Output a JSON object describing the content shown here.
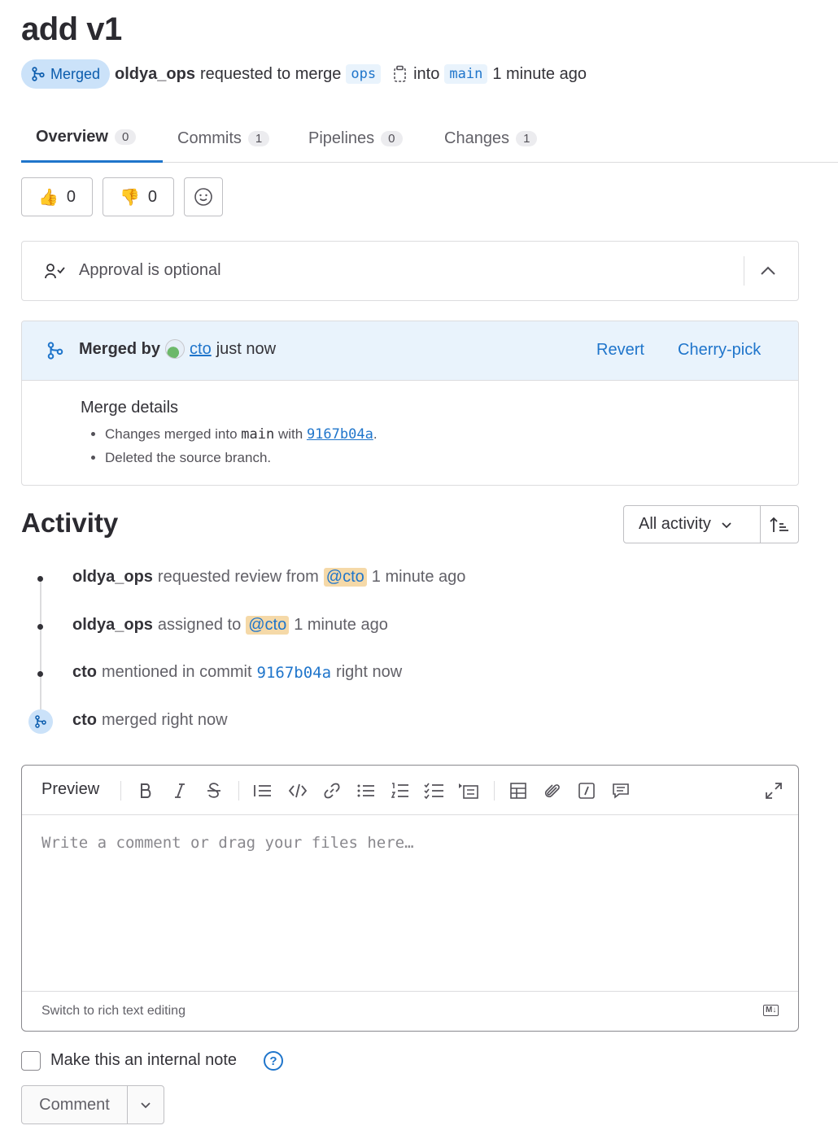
{
  "title": "add v1",
  "meta": {
    "status": "Merged",
    "author": "oldya_ops",
    "action": "requested to merge",
    "source_branch": "ops",
    "into": "into",
    "target_branch": "main",
    "time": "1 minute ago"
  },
  "tabs": [
    {
      "label": "Overview",
      "count": "0"
    },
    {
      "label": "Commits",
      "count": "1"
    },
    {
      "label": "Pipelines",
      "count": "0"
    },
    {
      "label": "Changes",
      "count": "1"
    }
  ],
  "reactions": {
    "thumbs_up": "0",
    "thumbs_down": "0"
  },
  "approval": {
    "text": "Approval is optional"
  },
  "merge": {
    "merged_by": "Merged by",
    "user": "cto",
    "when": "just now",
    "revert": "Revert",
    "cherry_pick": "Cherry-pick",
    "details_title": "Merge details",
    "line1_prefix": "Changes merged into",
    "line1_branch": "main",
    "line1_with": "with",
    "line1_sha": "9167b04a",
    "line1_end": ".",
    "line2": "Deleted the source branch."
  },
  "activity": {
    "title": "Activity",
    "filter": "All activity",
    "items": [
      {
        "user": "oldya_ops",
        "text": "requested review from",
        "mention": "@cto",
        "time": "1 minute ago"
      },
      {
        "user": "oldya_ops",
        "text": "assigned to",
        "mention": "@cto",
        "time": "1 minute ago"
      },
      {
        "user": "cto",
        "text": "mentioned in commit",
        "sha": "9167b04a",
        "time": "right now"
      },
      {
        "user": "cto",
        "text": "merged right now"
      }
    ]
  },
  "editor": {
    "preview": "Preview",
    "placeholder": "Write a comment or drag your files here…",
    "rich_text": "Switch to rich text editing",
    "md_badge": "M↓"
  },
  "internal_note": {
    "label": "Make this an internal note",
    "help": "?"
  },
  "comment_button": "Comment",
  "colors": {
    "accent": "#1f75cb",
    "merged_bg": "#cbe2f9",
    "mention_bg": "#f5d9a8"
  }
}
